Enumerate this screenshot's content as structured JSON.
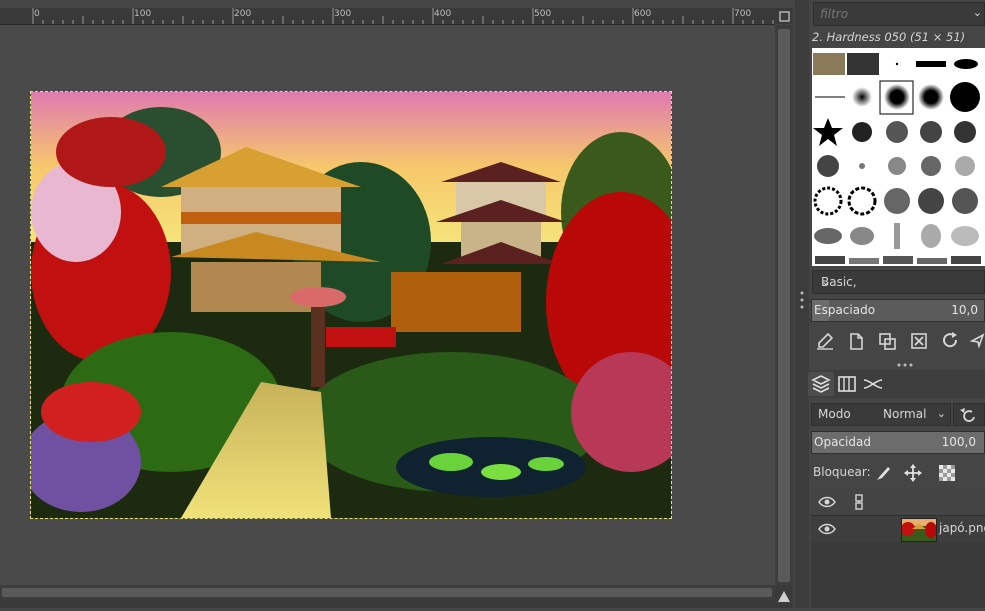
{
  "ruler": {
    "labels": [
      "0",
      "100",
      "200",
      "300",
      "400",
      "500",
      "600",
      "700"
    ]
  },
  "brushes": {
    "filter_placeholder": "filtro",
    "selected_name": "2. Hardness 050 (51 × 51)",
    "preset": "Basic,",
    "spacing_label": "Espaciado",
    "spacing_value": "10,0",
    "spacing_fraction": 0.1
  },
  "layers": {
    "mode_label": "Modo",
    "mode_value": "Normal",
    "opacity_label": "Opacidad",
    "opacity_value": "100,0",
    "opacity_fraction": 1.0,
    "lock_label": "Bloquear:",
    "items": [
      {
        "name": "japó.png",
        "visible": true
      }
    ]
  },
  "colors": {
    "accent_selection": "#e8e36b",
    "panel_bg": "#454545",
    "canvas_bg": "#4a4a4a"
  }
}
